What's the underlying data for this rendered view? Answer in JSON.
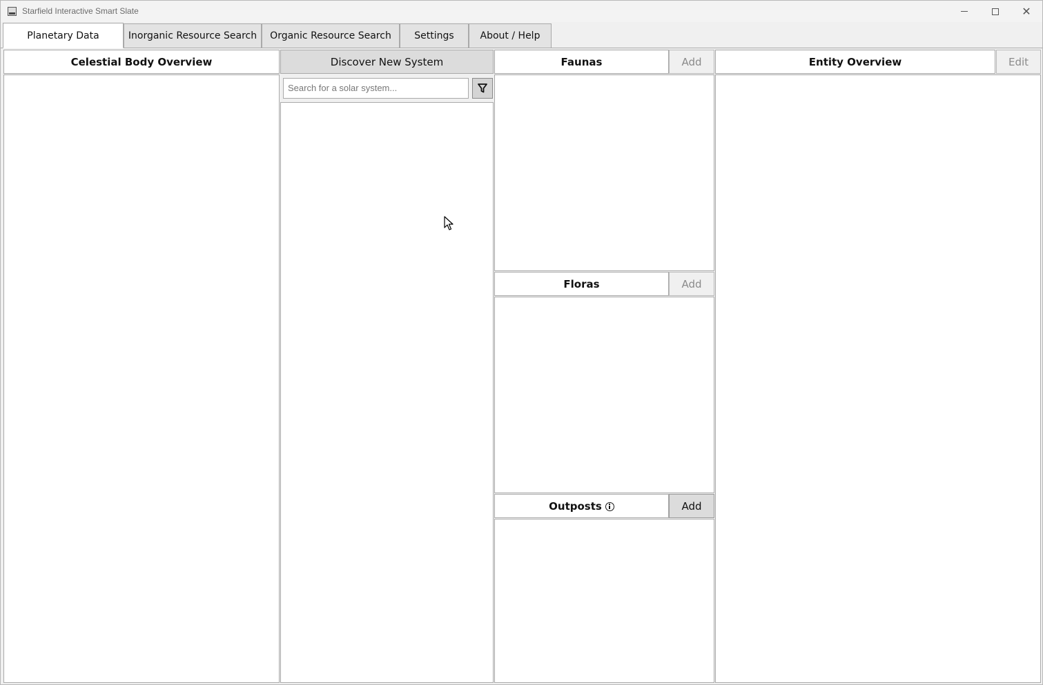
{
  "window": {
    "title": "Starfield Interactive Smart Slate"
  },
  "tabs": [
    {
      "label": "Planetary Data",
      "active": true
    },
    {
      "label": "Inorganic Resource Search",
      "active": false
    },
    {
      "label": "Organic Resource Search",
      "active": false
    },
    {
      "label": "Settings",
      "active": false
    },
    {
      "label": "About / Help",
      "active": false
    }
  ],
  "celestial": {
    "header": "Celestial Body Overview"
  },
  "systems": {
    "header": "Discover New System",
    "search_placeholder": "Search for a solar system..."
  },
  "faunas": {
    "header": "Faunas",
    "add_label": "Add"
  },
  "floras": {
    "header": "Floras",
    "add_label": "Add"
  },
  "outposts": {
    "header": "Outposts",
    "add_label": "Add"
  },
  "entity": {
    "header": "Entity Overview",
    "edit_label": "Edit"
  }
}
